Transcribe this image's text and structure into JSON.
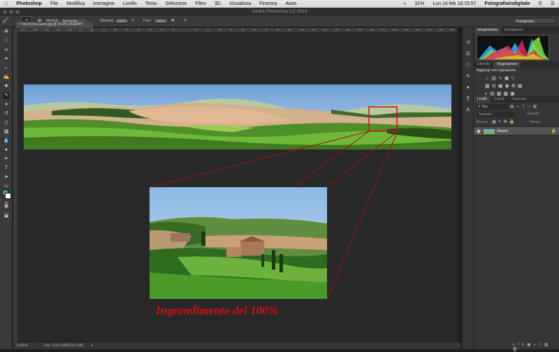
{
  "menubar": {
    "app": "Photoshop",
    "items": [
      "File",
      "Modifica",
      "Immagine",
      "Livello",
      "Testo",
      "Selezione",
      "Filtro",
      "3D",
      "Visualizza",
      "Finestra",
      "Aiuto"
    ],
    "battery": "31%",
    "clock": "Lun 16 feb  18:15:57",
    "user": "Fotografiaindigitale"
  },
  "titlebar": {
    "title": "Adobe Photoshop CC 2014"
  },
  "options": {
    "brush_size": "600",
    "metodo_label": "Metodo:",
    "metodo_value": "Normale",
    "opacita_label": "Opacità:",
    "opacita_value": "100%",
    "flux_label": "Flux:",
    "flux_value": "100%",
    "workspace": "Fotografia"
  },
  "document": {
    "tab_title": "Val d'orcia pano.jpg @ 10,9% (RGB/8*)",
    "zoom": "10,86%",
    "doc_info": "Doc: 318,4 MB/318,4 MB"
  },
  "ruler": {
    "ticks": [
      "140",
      "130",
      "120",
      "110",
      "100",
      "90",
      "80",
      "70",
      "60",
      "50",
      "40",
      "30",
      "20",
      "10",
      "0",
      "10",
      "20",
      "30",
      "40",
      "50",
      "60",
      "70",
      "80",
      "90",
      "100",
      "110",
      "120",
      "130",
      "140",
      "150",
      "160",
      "170",
      "180",
      "190",
      "200",
      "210",
      "220",
      "230",
      "240"
    ]
  },
  "panels": {
    "histogram_tabs": [
      "Istogramma",
      "Navigatore"
    ],
    "adjust_tabs": [
      "Librerie",
      "Regolazioni"
    ],
    "adjust_heading": "Aggiungi una regolazione",
    "layers_tabs": [
      "Livelli",
      "Canali",
      "Tracciati"
    ],
    "kind_filter": "Tipo",
    "blend_mode": "Normale",
    "opacity_label": "Opacità:",
    "lock_label": "Blocca:",
    "fill_label": "Riemp.:",
    "layer_name": "Sfondo"
  },
  "caption": "Ingrandimento del 100%",
  "colors": {
    "accent_red": "#d01010",
    "foreground_swatch": "#3aa17e",
    "background_swatch": "#ffffff"
  }
}
